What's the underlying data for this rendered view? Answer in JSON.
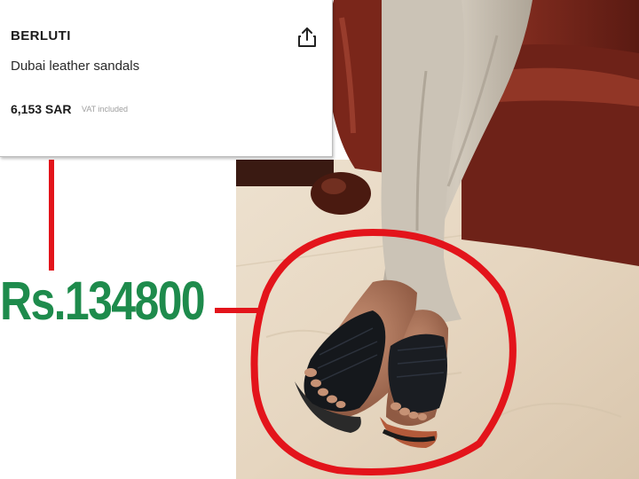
{
  "product": {
    "brand": "BERLUTI",
    "name": "Dubai leather sandals",
    "price": "6,153 SAR",
    "vat_note": "VAT included",
    "share_icon": "share-icon"
  },
  "annotation": {
    "converted_price": "Rs.134800",
    "accent_color": "#e3141b",
    "price_color": "#1e8b4c"
  },
  "photo": {
    "subject": "crossed legs in light grey trousers wearing black woven leather sandals on a marble floor beside a brown leather chair"
  }
}
